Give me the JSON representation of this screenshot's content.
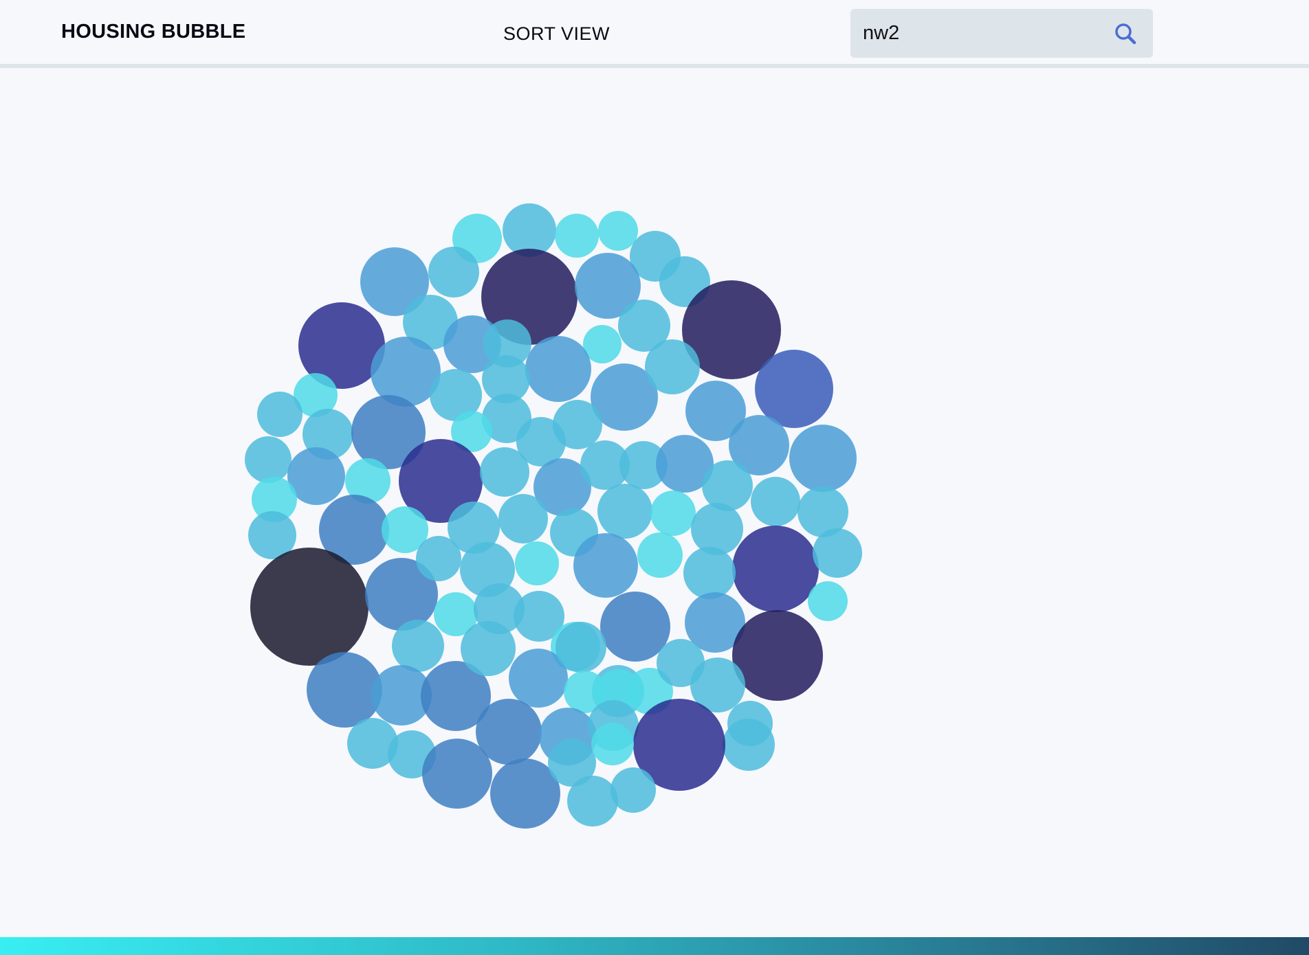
{
  "app": {
    "title": "HOUSING BUBBLE"
  },
  "nav": {
    "sort_view_label": "SORT VIEW"
  },
  "search": {
    "value": "nw2",
    "icon": "search-icon",
    "icon_color": "#4a6cd4"
  },
  "colors": {
    "page_background": "#f6f8fc",
    "search_background": "#dde4ea",
    "divider": "#dde4ea",
    "footer_gradient": [
      "#38eef2",
      "#2fb7c4",
      "#2a8aa0",
      "#214a66"
    ]
  },
  "bubbles_visualization": {
    "type": "packed-bubble-cluster",
    "labels_shown": false,
    "color_scale": [
      "#4fdbe6",
      "#4dbcdc",
      "#4a9dd6",
      "#3f7fc2",
      "#3a5cb8",
      "#2a2e8e",
      "#231c5e",
      "#1a1a2e"
    ]
  }
}
